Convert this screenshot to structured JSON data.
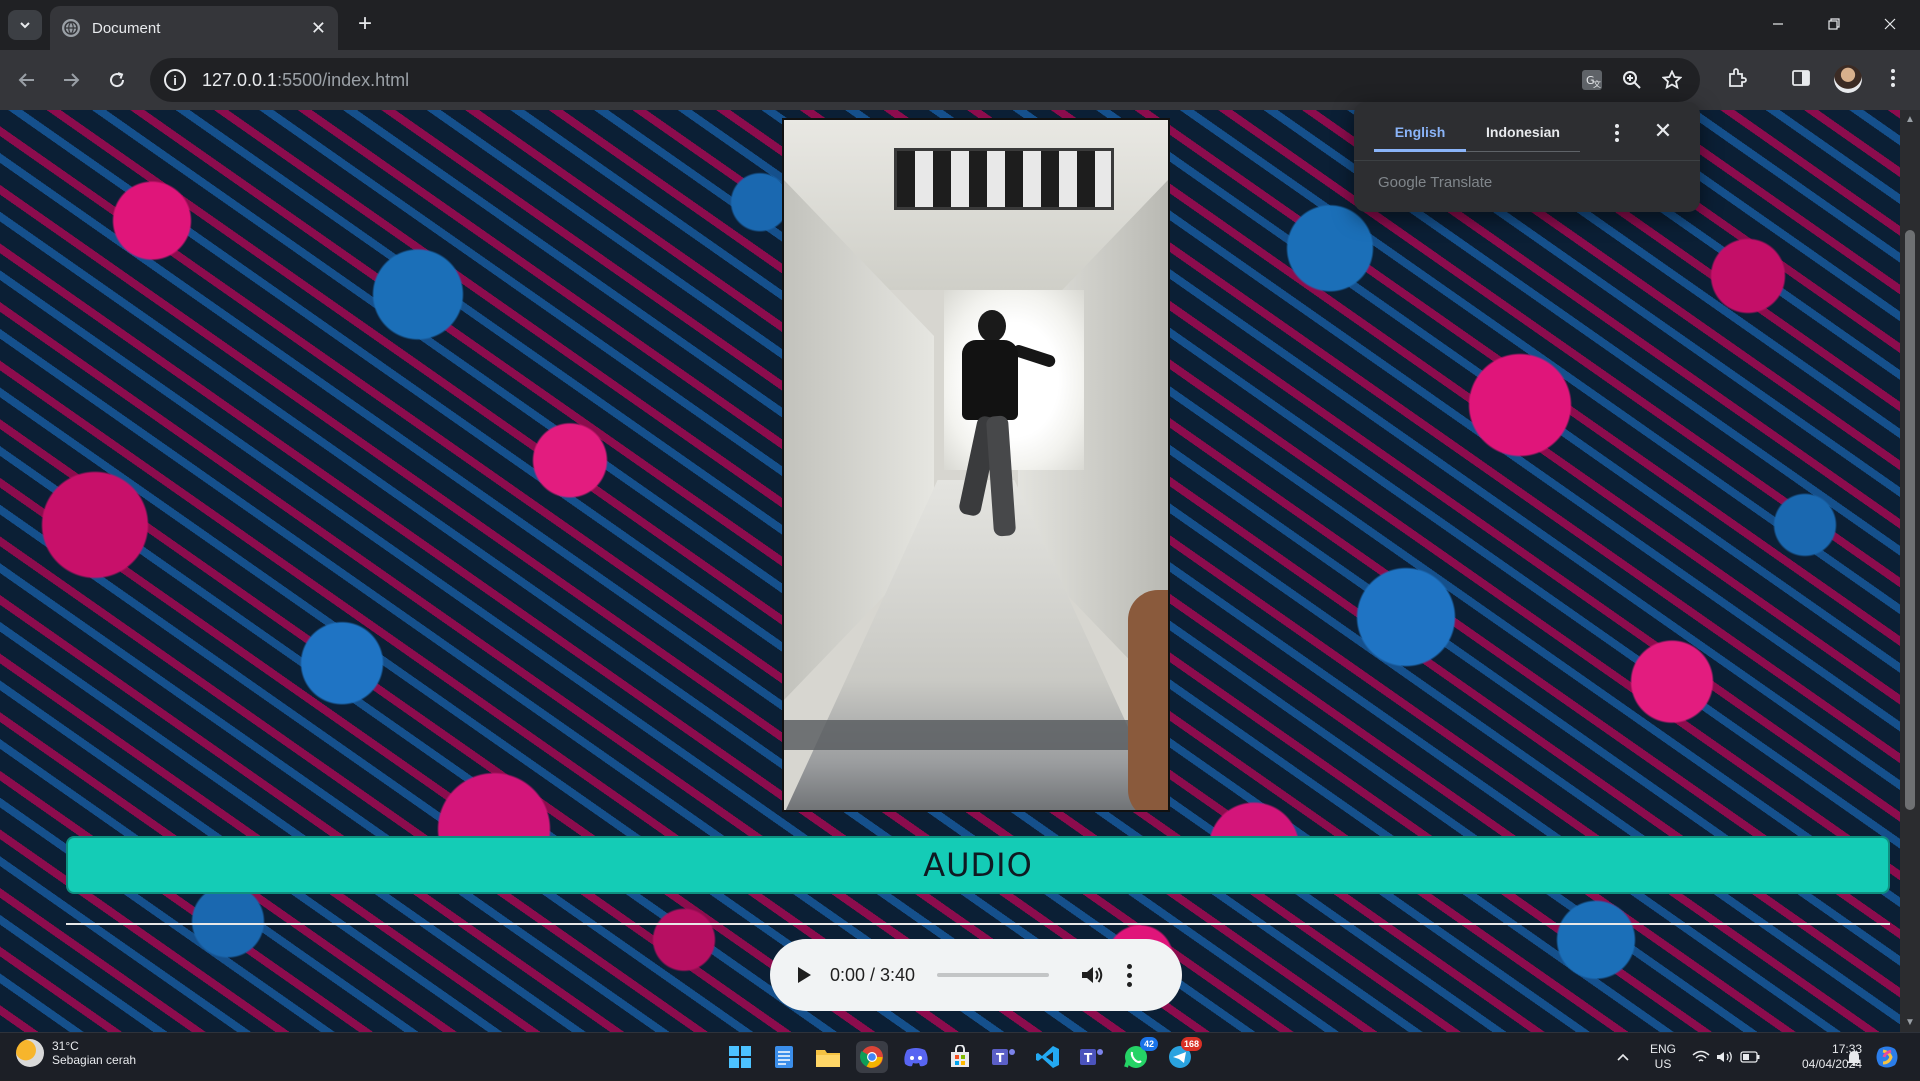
{
  "browser": {
    "tab_title": "Document",
    "url_host": "127.0.0.1",
    "url_rest": ":5500/index.html"
  },
  "translate_popup": {
    "tab_active": "English",
    "tab_other": "Indonesian",
    "footer": "Google Translate"
  },
  "page": {
    "heading": "AUDIO",
    "audio_player": {
      "time_display": "0:00 / 3:40",
      "progress": 0
    },
    "colors": {
      "heading_bg": "#14ccb6",
      "player_bg": "#f1f3f4"
    }
  },
  "taskbar": {
    "weather_temp": "31°C",
    "weather_desc": "Sebagian cerah",
    "lang_line1": "ENG",
    "lang_line2": "US",
    "time": "17:33",
    "date": "04/04/2024",
    "apps": [
      {
        "name": "start-menu",
        "icon": "windows-icon"
      },
      {
        "name": "notepad",
        "icon": "notepad-icon"
      },
      {
        "name": "file-explorer",
        "icon": "folder-icon"
      },
      {
        "name": "chrome",
        "icon": "chrome-icon"
      },
      {
        "name": "discord",
        "icon": "discord-icon"
      },
      {
        "name": "microsoft-store",
        "icon": "store-icon"
      },
      {
        "name": "teams",
        "icon": "teams-icon"
      },
      {
        "name": "vscode",
        "icon": "vscode-icon"
      },
      {
        "name": "teams-classic",
        "icon": "teams-icon"
      },
      {
        "name": "whatsapp",
        "icon": "whatsapp-icon",
        "badge": "42"
      },
      {
        "name": "telegram",
        "icon": "telegram-icon",
        "badge": "168"
      }
    ]
  }
}
